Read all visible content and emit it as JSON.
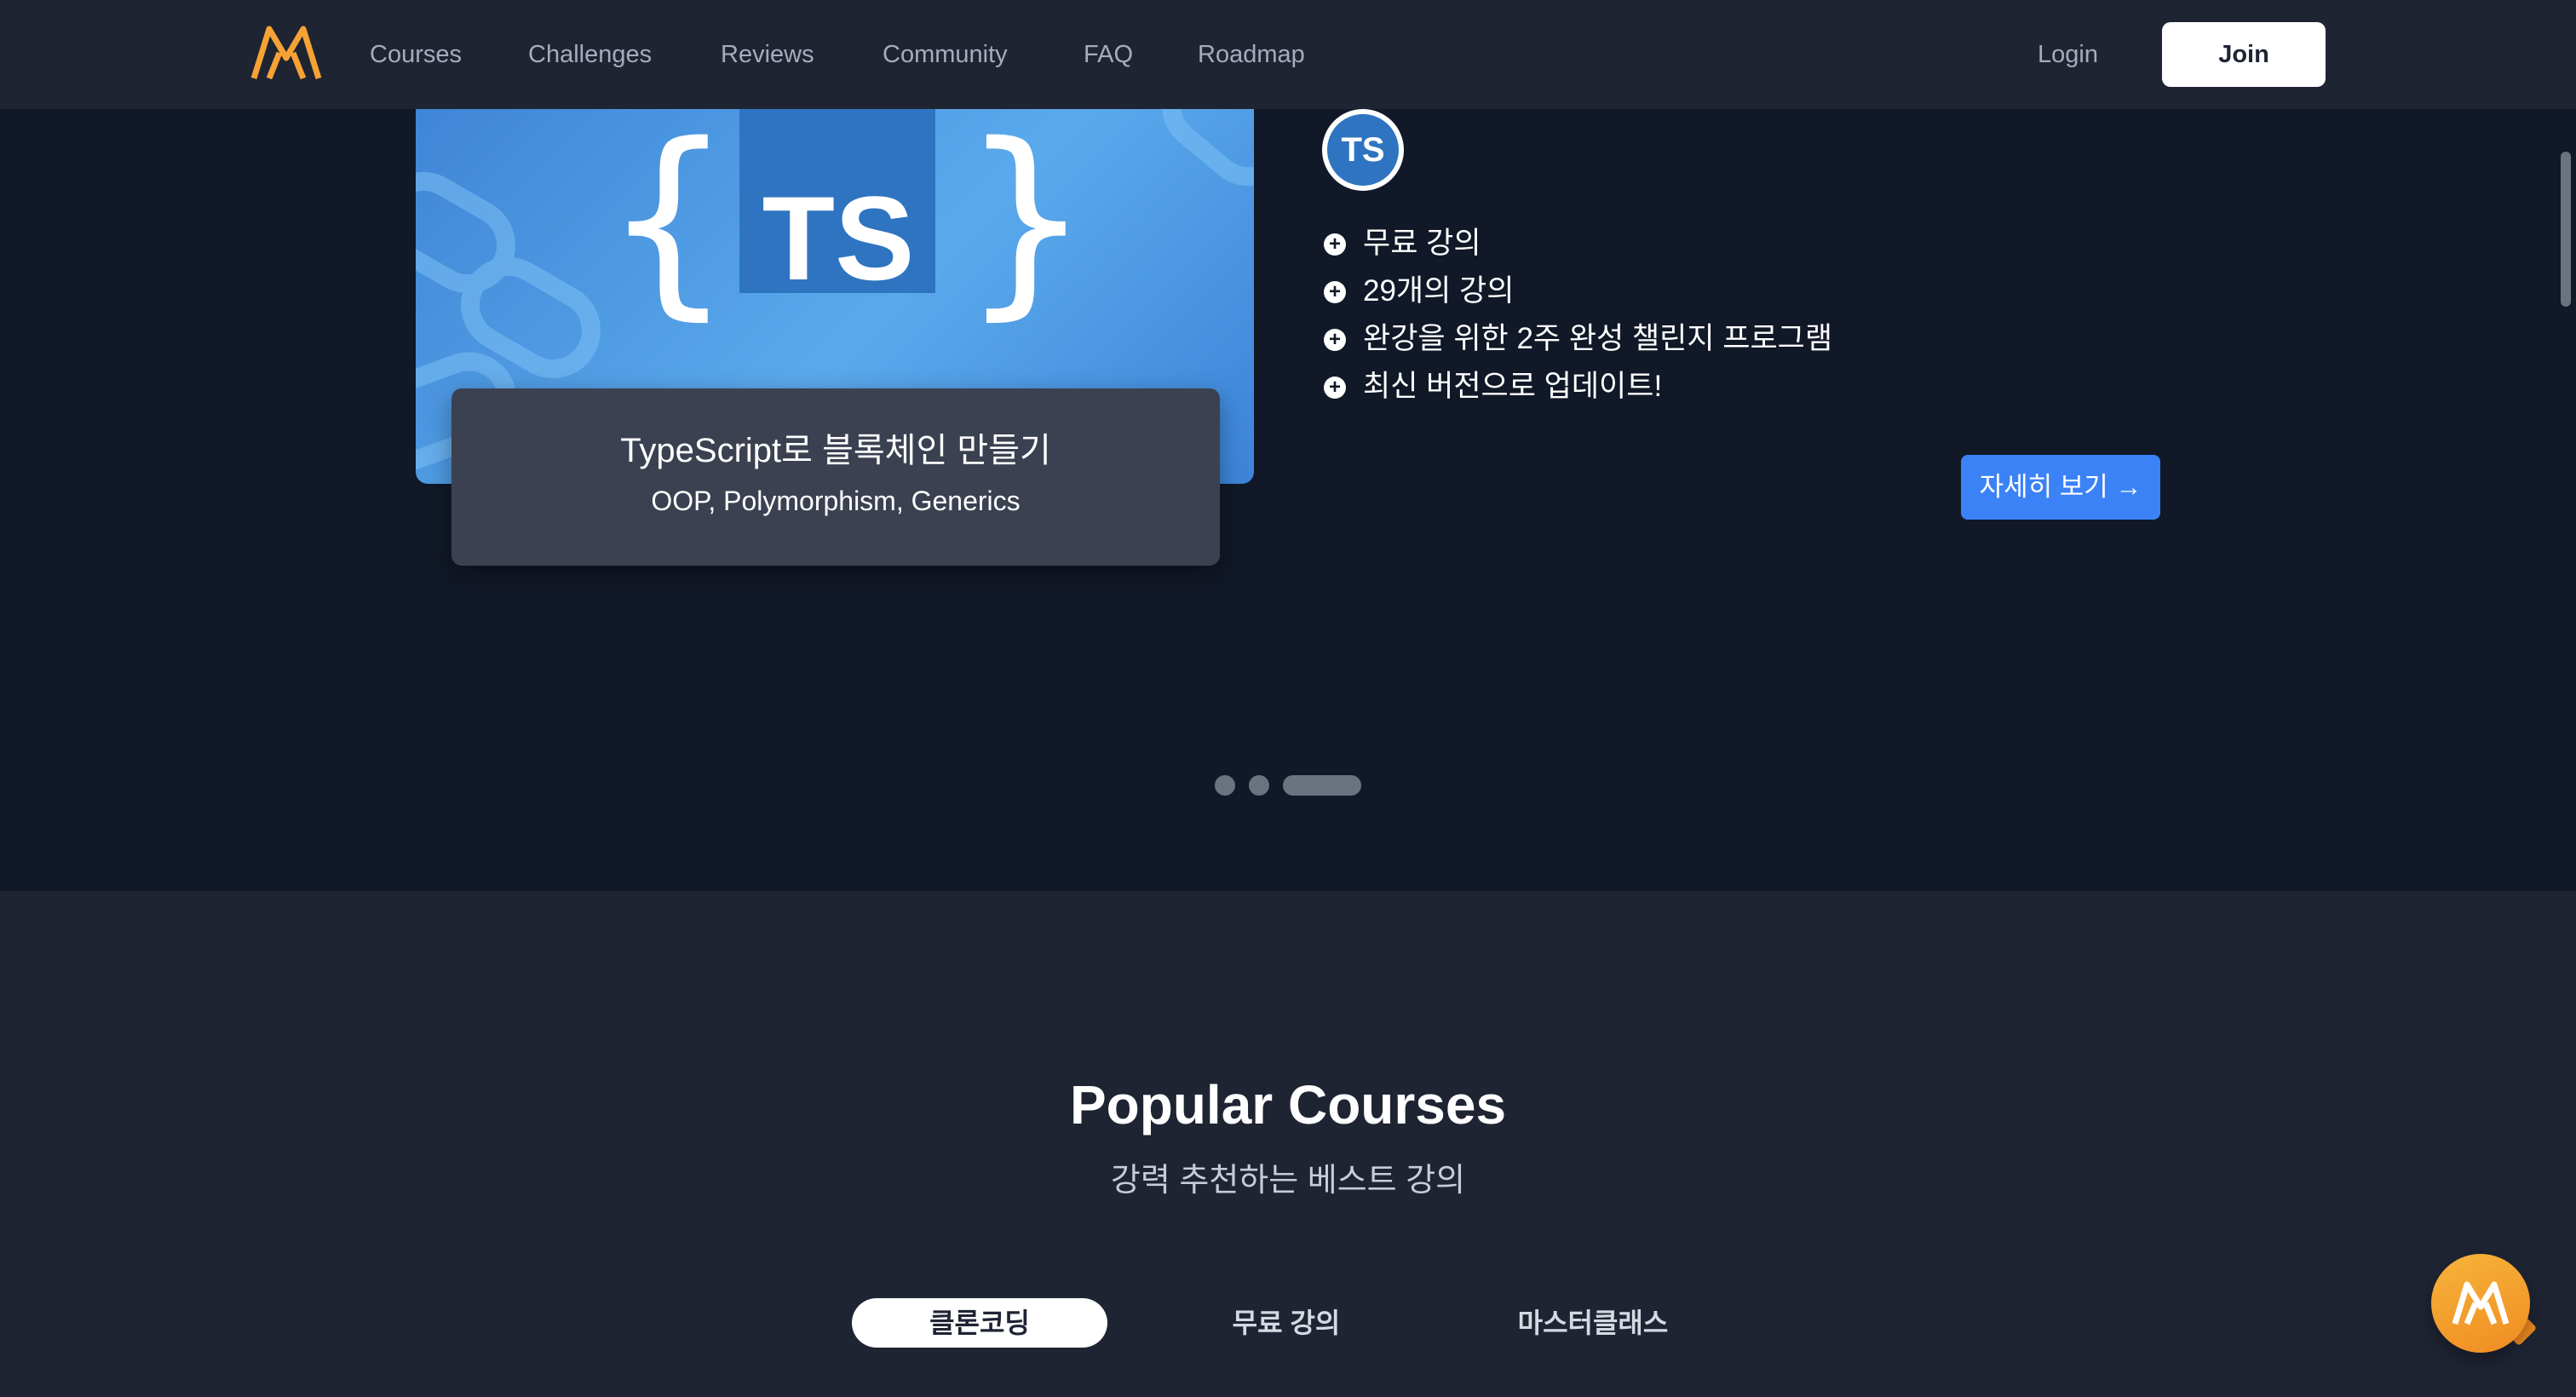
{
  "nav": {
    "logo": "nomad-logo-icon",
    "links": [
      "Courses",
      "Challenges",
      "Reviews",
      "Community",
      "FAQ",
      "Roadmap"
    ],
    "login": "Login",
    "join": "Join"
  },
  "hero": {
    "image_text": "TS",
    "card_title": "TypeScript로 블록체인 만들기",
    "card_subtitle": "OOP, Polymorphism, Generics",
    "badge": "TS",
    "features": [
      "무료 강의",
      "29개의 강의",
      "완강을 위한 2주 완성 챌린지 프로그램",
      "최신 버전으로 업데이트!"
    ],
    "detail_button": "자세히 보기 →",
    "slide_count": 3,
    "active_slide": 3
  },
  "popular": {
    "title": "Popular Courses",
    "subtitle": "강력 추천하는 베스트 강의",
    "tabs": [
      "클론코딩",
      "무료 강의",
      "마스터클래스"
    ],
    "active_tab": 0
  },
  "colors": {
    "nav_bg": "#1f2433",
    "hero_bg": "#111827",
    "accent_orange": "#f6a234",
    "button_blue": "#3b82f6",
    "ts_blue": "#2f74c0"
  }
}
